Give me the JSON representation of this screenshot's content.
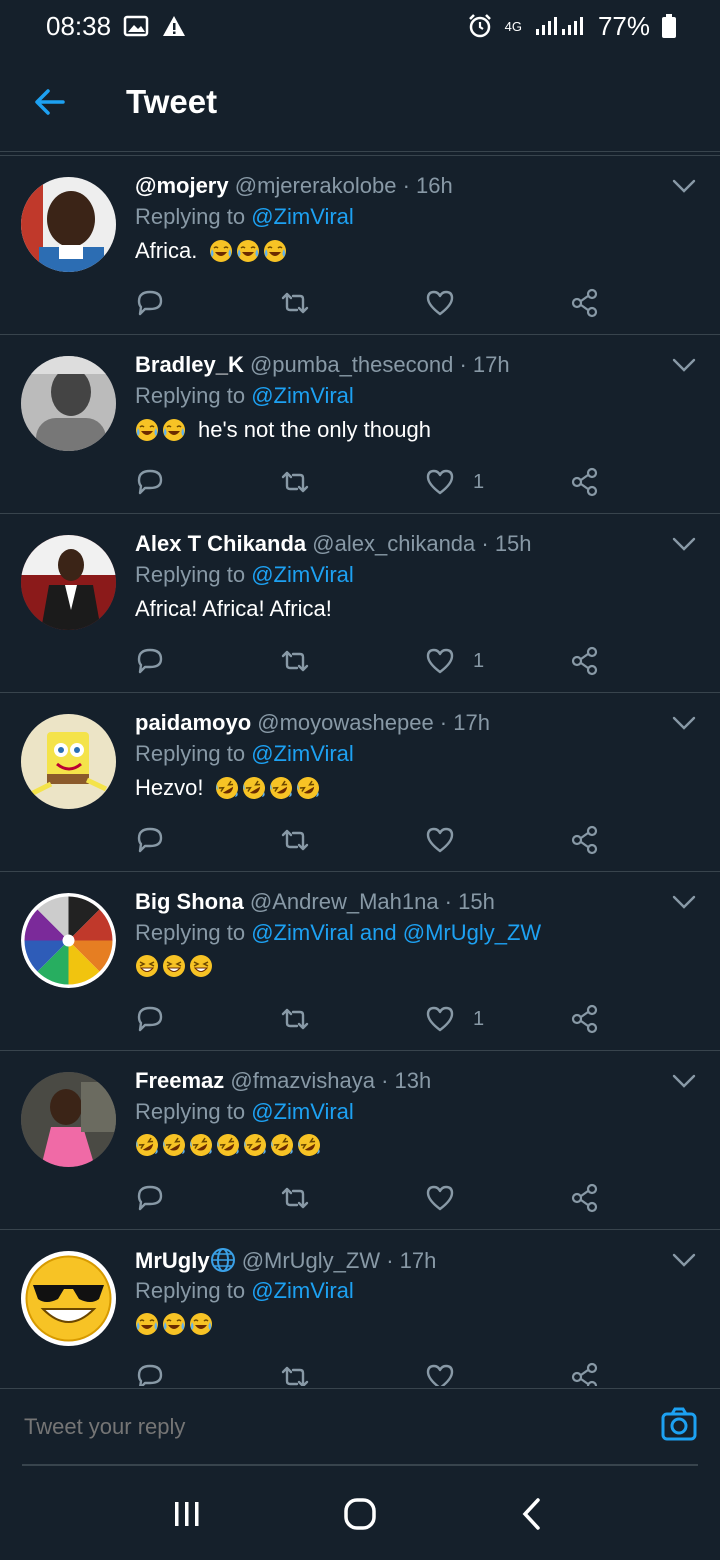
{
  "status": {
    "time": "08:38",
    "network": "4G",
    "battery": "77%"
  },
  "header": {
    "title": "Tweet"
  },
  "replying_prefix": "Replying to",
  "tweets": [
    {
      "name": "@mojery",
      "handle": "@mjererakolobe · 16h",
      "reply_to": "@ZimViral",
      "text": "Africa.",
      "emoji": [
        "tears-of-joy",
        "tears-of-joy",
        "tears-of-joy"
      ],
      "likes": "",
      "avatar": "red-shirt-man"
    },
    {
      "name": "Bradley_K",
      "handle": "@pumba_thesecond · 17h",
      "reply_to": "@ZimViral",
      "emoji_before": [
        "tears-of-joy",
        "tears-of-joy"
      ],
      "text": "he's not the only though",
      "likes": "1",
      "avatar": "grayscale-man"
    },
    {
      "name": "Alex T Chikanda",
      "handle": "@alex_chikanda · 15h",
      "reply_to": "@ZimViral",
      "text": "Africa! Africa! Africa!",
      "likes": "1",
      "avatar": "suit-man"
    },
    {
      "name": "paidamoyo",
      "handle": "@moyowashepee · 17h",
      "reply_to": "@ZimViral",
      "text": "Hezvo!",
      "emoji": [
        "rofl",
        "rofl",
        "rofl",
        "rofl"
      ],
      "likes": "",
      "avatar": "spongebob"
    },
    {
      "name": "Big Shona",
      "handle": "@Andrew_Mah1na · 15h",
      "reply_to": "@ZimViral and @MrUgly_ZW",
      "text": "",
      "emoji": [
        "grinning-squint",
        "grinning-squint",
        "grinning-squint"
      ],
      "likes": "1",
      "avatar": "color-wheel"
    },
    {
      "name": "Freemaz",
      "handle": "@fmazvishaya · 13h",
      "reply_to": "@ZimViral",
      "text": "",
      "emoji": [
        "rofl",
        "rofl",
        "rofl",
        "rofl",
        "rofl",
        "rofl",
        "rofl"
      ],
      "likes": "",
      "avatar": "child-pink"
    },
    {
      "name": "MrUgly",
      "handle": "@MrUgly_ZW · 17h",
      "reply_to": "@ZimViral",
      "text": "",
      "emoji": [
        "tears-of-joy",
        "tears-of-joy",
        "tears-of-joy"
      ],
      "likes": "",
      "avatar": "sunglasses-smiley",
      "globe": true
    }
  ],
  "composer": {
    "placeholder": "Tweet your reply"
  },
  "colors": {
    "background": "#15202b",
    "accent": "#1da1f2",
    "muted": "#8899a6",
    "divider": "#38444d"
  }
}
